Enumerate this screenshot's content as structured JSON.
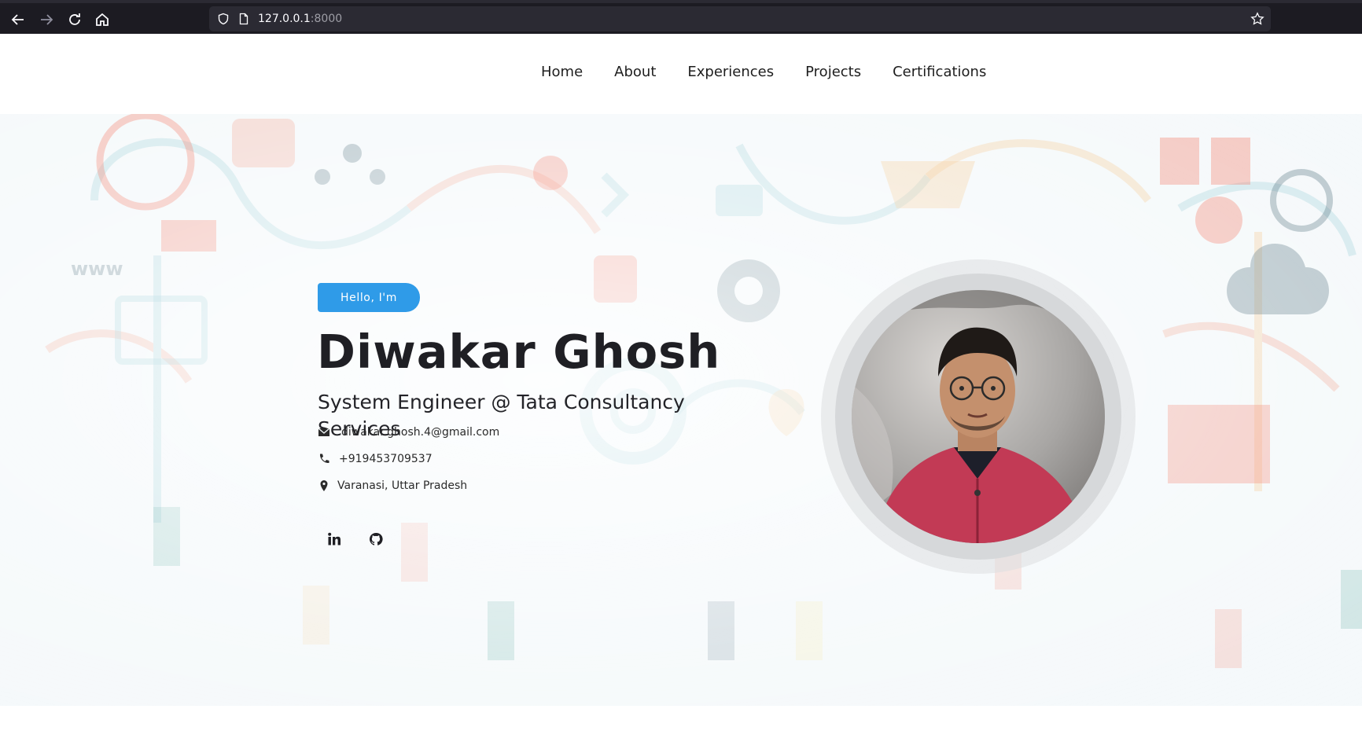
{
  "browser": {
    "url_host": "127.0.0.1",
    "url_port": ":8000"
  },
  "nav": {
    "items": [
      "Home",
      "About",
      "Experiences",
      "Projects",
      "Certifications"
    ]
  },
  "hero": {
    "greeting": "Hello, I'm",
    "name": "Diwakar Ghosh",
    "title": "System Engineer @ Tata Consultancy Services",
    "email": "diwakar.ghosh.4@gmail.com",
    "phone": "+919453709537",
    "location": "Varanasi, Uttar Pradesh"
  },
  "social": [
    "linkedin-icon",
    "github-icon"
  ],
  "colors": {
    "accent": "#2f9be8",
    "text": "#1f1f24",
    "chrome": "#1c1b22"
  }
}
